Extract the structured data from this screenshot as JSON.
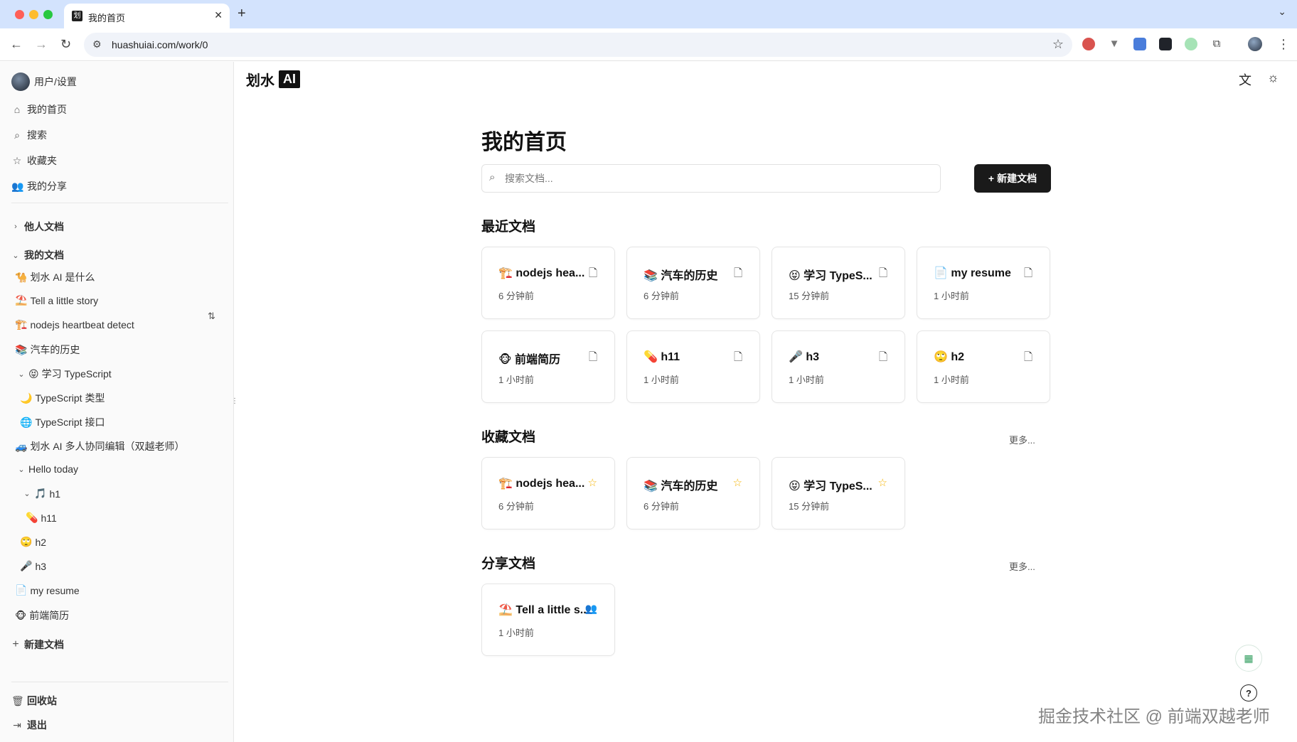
{
  "browser": {
    "tab_title": "我的首页",
    "tab_favicon": "划",
    "url": "huashuiai.com/work/0"
  },
  "sidebar": {
    "user_label": "用户/设置",
    "nav": [
      {
        "icon": "home-icon",
        "label": "我的首页"
      },
      {
        "icon": "search-icon",
        "label": "搜索"
      },
      {
        "icon": "star-icon",
        "label": "收藏夹"
      },
      {
        "icon": "users-icon",
        "label": "我的分享"
      }
    ],
    "others_docs": "他人文档",
    "my_docs": "我的文档",
    "tree": [
      {
        "emoji": "🐪",
        "label": "划水 AI 是什么"
      },
      {
        "emoji": "⛱️",
        "label": "Tell a little story"
      },
      {
        "emoji": "🏗️",
        "label": "nodejs heartbeat detect"
      },
      {
        "emoji": "📚",
        "label": "汽车的历史"
      },
      {
        "emoji": "😝",
        "label": "学习 TypeScript"
      },
      {
        "emoji": "🌙",
        "label": "TypeScript 类型"
      },
      {
        "emoji": "🌐",
        "label": "TypeScript 接口"
      },
      {
        "emoji": "🚙",
        "label": "划水 AI 多人协同编辑（双越老师）"
      },
      {
        "emoji": "",
        "label": "Hello today"
      },
      {
        "emoji": "🎵",
        "label": "h1"
      },
      {
        "emoji": "💊",
        "label": "h11"
      },
      {
        "emoji": "🙄",
        "label": "h2"
      },
      {
        "emoji": "🎤",
        "label": "h3"
      },
      {
        "emoji": "📄",
        "label": "my resume"
      },
      {
        "emoji": "🐵",
        "label": "前端简历"
      }
    ],
    "new_doc": "新建文档",
    "trash": "回收站",
    "logout": "退出"
  },
  "main": {
    "logo_text": "划水",
    "logo_box": "AI",
    "page_title": "我的首页",
    "search_placeholder": "搜索文档...",
    "new_doc_button": "新建文档",
    "recent_title": "最近文档",
    "recent": [
      {
        "emoji": "🏗️",
        "title": "nodejs hea...",
        "time": "6 分钟前"
      },
      {
        "emoji": "📚",
        "title": "汽车的历史",
        "time": "6 分钟前"
      },
      {
        "emoji": "😝",
        "title": "学习 TypeS...",
        "time": "15 分钟前"
      },
      {
        "emoji": "📄",
        "title": "my resume",
        "time": "1 小时前"
      },
      {
        "emoji": "🐵",
        "title": "前端简历",
        "time": "1 小时前"
      },
      {
        "emoji": "💊",
        "title": "h11",
        "time": "1 小时前"
      },
      {
        "emoji": "🎤",
        "title": "h3",
        "time": "1 小时前"
      },
      {
        "emoji": "🙄",
        "title": "h2",
        "time": "1 小时前"
      }
    ],
    "fav_title": "收藏文档",
    "fav_more": "更多...",
    "favorites": [
      {
        "emoji": "🏗️",
        "title": "nodejs hea...",
        "time": "6 分钟前"
      },
      {
        "emoji": "📚",
        "title": "汽车的历史",
        "time": "6 分钟前"
      },
      {
        "emoji": "😝",
        "title": "学习 TypeS...",
        "time": "15 分钟前"
      }
    ],
    "share_title": "分享文档",
    "share_more": "更多...",
    "shared": [
      {
        "emoji": "⛱️",
        "title": "Tell a little s...",
        "time": "1 小时前"
      }
    ]
  },
  "watermark": "掘金技术社区 @ 前端双越老师"
}
